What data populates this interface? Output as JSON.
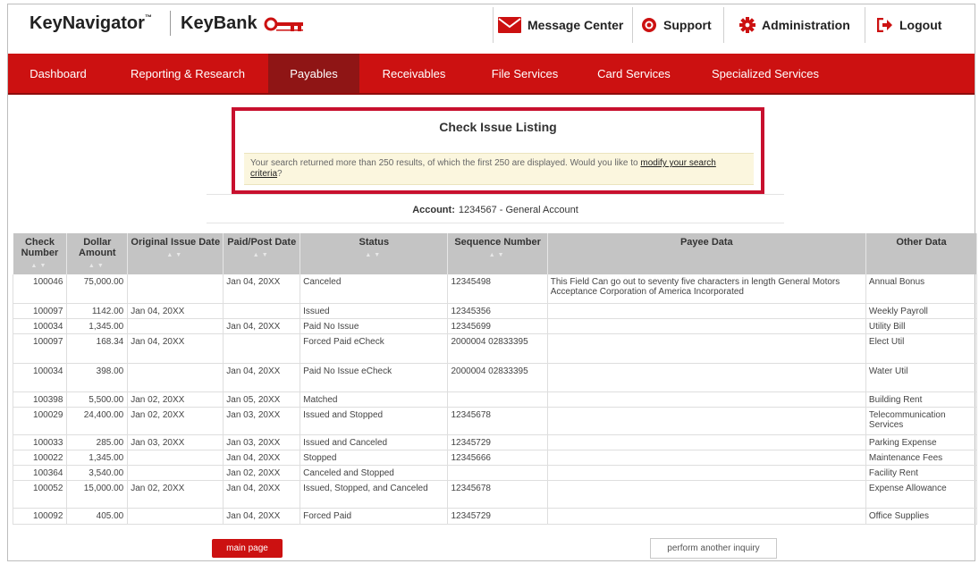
{
  "header": {
    "brand_primary": "KeyNavigator",
    "brand_tm": "™",
    "brand_secondary": "KeyBank",
    "links": {
      "messages": "Message Center",
      "support": "Support",
      "admin": "Administration",
      "logout": "Logout"
    },
    "icons": [
      "envelope-icon",
      "lifebuoy-icon",
      "gear-icon",
      "logout-icon"
    ],
    "colors": {
      "brand_red": "#cc1111",
      "nav_active": "#8f1515"
    }
  },
  "nav": {
    "items": [
      "Dashboard",
      "Reporting & Research",
      "Payables",
      "Receivables",
      "File Services",
      "Card Services",
      "Specialized Services"
    ],
    "active": "Payables"
  },
  "alert": {
    "title": "Check Issue Listing",
    "message_prefix": "Your search returned more than 250 results, of which the first 250 are displayed. Would you like to ",
    "link": "modify your search criteria",
    "message_suffix": "?"
  },
  "account": {
    "label": "Account:",
    "value": "1234567 - General Account"
  },
  "table": {
    "headers": {
      "check": "Check Number",
      "amount": "Dollar Amount",
      "issue": "Original Issue Date",
      "paid": "Paid/Post Date",
      "status": "Status",
      "sequence": "Sequence Number",
      "payee": "Payee Data",
      "other": "Other Data"
    },
    "rows": [
      [
        "100046",
        "75,000.00",
        "",
        "Jan 04, 20XX",
        "Canceled",
        "12345498",
        "This Field Can go out to seventy five characters in length General Motors Acceptance Corporation of America Incorporated",
        "Annual Bonus"
      ],
      [
        "100097",
        "1142.00",
        "Jan 04, 20XX",
        "",
        "Issued",
        "12345356",
        "",
        "Weekly Payroll"
      ],
      [
        "100034",
        "1,345.00",
        "",
        "Jan 04, 20XX",
        "Paid No Issue",
        "12345699",
        "",
        "Utility Bill"
      ],
      [
        "100097",
        "168.34",
        "Jan 04, 20XX",
        "",
        "Forced Paid eCheck",
        "2000004 02833395",
        "",
        "Elect Util"
      ],
      [
        "100034",
        "398.00",
        "",
        "Jan 04, 20XX",
        "Paid No Issue eCheck",
        "2000004 02833395",
        "",
        "Water Util"
      ],
      [
        "100398",
        "5,500.00",
        "Jan 02, 20XX",
        "Jan 05, 20XX",
        "Matched",
        "",
        "",
        "Building Rent"
      ],
      [
        "100029",
        "24,400.00",
        "Jan 02, 20XX",
        "Jan 03, 20XX",
        "Issued and Stopped",
        "12345678",
        "",
        "Telecommunication Services"
      ],
      [
        "100033",
        "285.00",
        "Jan 03, 20XX",
        "Jan 03, 20XX",
        "Issued and Canceled",
        "12345729",
        "",
        "Parking Expense"
      ],
      [
        "100022",
        "1,345.00",
        "",
        "Jan 04, 20XX",
        "Stopped",
        "12345666",
        "",
        "Maintenance Fees"
      ],
      [
        "100364",
        "3,540.00",
        "",
        "Jan 02, 20XX",
        "Canceled and Stopped",
        "",
        "",
        "Facility Rent"
      ],
      [
        "100052",
        "15,000.00",
        "Jan 02, 20XX",
        "Jan 04, 20XX",
        "Issued, Stopped, and Canceled",
        "12345678",
        "",
        "Expense Allowance"
      ],
      [
        "100092",
        "405.00",
        "",
        "Jan 04, 20XX",
        "Forced Paid",
        "12345729",
        "",
        "Office Supplies"
      ]
    ]
  },
  "buttons": {
    "main_page": "main page",
    "another_inquiry": "perform another inquiry"
  }
}
